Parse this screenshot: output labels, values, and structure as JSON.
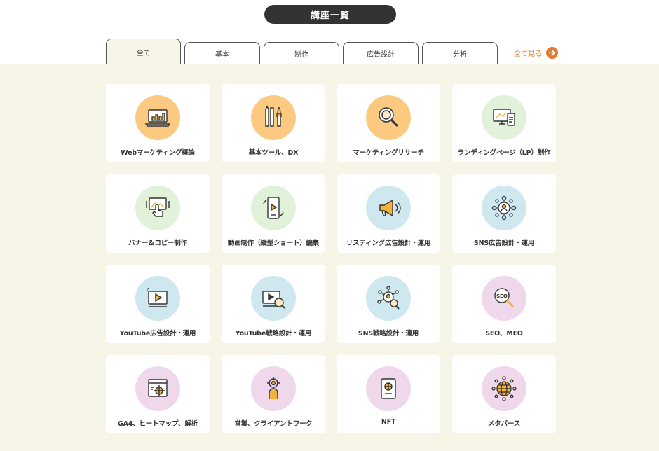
{
  "header": {
    "title": "講座一覧"
  },
  "tabs": [
    {
      "label": "全て",
      "active": true
    },
    {
      "label": "基本",
      "active": false
    },
    {
      "label": "制作",
      "active": false
    },
    {
      "label": "広告設計",
      "active": false
    },
    {
      "label": "分析",
      "active": false
    }
  ],
  "see_all": {
    "label": "全て見る",
    "icon": "arrow-right-icon"
  },
  "colors": {
    "orange": "#fcc981",
    "green": "#e2f1da",
    "blue": "#cfe7ee",
    "pink": "#efd8ec",
    "accent": "#e07b2f",
    "background": "#f7f4e8"
  },
  "courses": [
    {
      "label": "Webマーケティング概論",
      "icon": "laptop-chart-icon",
      "color": "orange"
    },
    {
      "label": "基本ツール、DX",
      "icon": "pencil-brush-icon",
      "color": "orange"
    },
    {
      "label": "マーケティングリサーチ",
      "icon": "magnifier-icon",
      "color": "orange"
    },
    {
      "label": "ランディングページ（LP）制作",
      "icon": "monitor-phone-icon",
      "color": "green"
    },
    {
      "label": "バナー＆コピー制作",
      "icon": "banner-hand-icon",
      "color": "green"
    },
    {
      "label": "動画制作（縦型ショート）編集",
      "icon": "vertical-video-icon",
      "color": "green"
    },
    {
      "label": "リスティング広告設計・運用",
      "icon": "megaphone-icon",
      "color": "blue"
    },
    {
      "label": "SNS広告設計・運用",
      "icon": "network-person-icon",
      "color": "blue"
    },
    {
      "label": "YouTube広告設計・運用",
      "icon": "video-play-icon",
      "color": "blue"
    },
    {
      "label": "YouTube戦略設計・運用",
      "icon": "video-analytics-icon",
      "color": "blue"
    },
    {
      "label": "SNS戦略設計・運用",
      "icon": "network-search-icon",
      "color": "blue"
    },
    {
      "label": "SEO、MEO",
      "icon": "seo-magnifier-icon",
      "color": "pink"
    },
    {
      "label": "GA4、ヒートマップ、解析",
      "icon": "heatmap-target-icon",
      "color": "pink"
    },
    {
      "label": "営業、クライアントワーク",
      "icon": "person-target-icon",
      "color": "pink"
    },
    {
      "label": "NFT",
      "icon": "passport-icon",
      "color": "pink"
    },
    {
      "label": "メタバース",
      "icon": "globe-network-icon",
      "color": "pink"
    }
  ]
}
